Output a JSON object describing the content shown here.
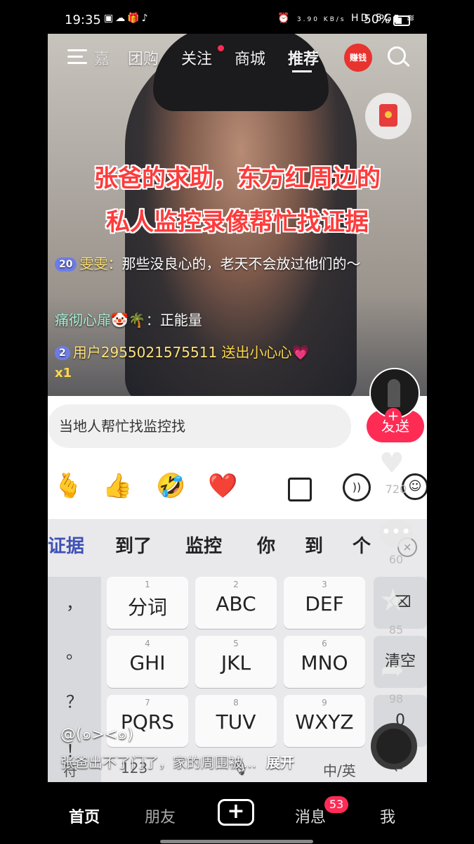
{
  "status": {
    "time": "19:35",
    "net_speed": "3.90 KB/s",
    "signal": "5G",
    "battery": "50%"
  },
  "topnav": {
    "partial_tab": "嘉",
    "tabs": [
      "团购",
      "关注",
      "商城",
      "推荐"
    ],
    "earn_label": "赚钱"
  },
  "video": {
    "title_line1": "张爸的求助，东方红周边的",
    "title_line2": "私人监控录像帮忙找证据"
  },
  "chat": [
    {
      "badge": "20",
      "user": "雯雯：",
      "text": "那些没良心的，老天不会放过他们的～"
    },
    {
      "user": "痛彻心扉🤡🌴：",
      "text": "正能量"
    },
    {
      "badge": "2",
      "user": "用户2955021575511",
      "text": "送出小心心💗",
      "count": "x1"
    }
  ],
  "input": {
    "value": "当地人帮忙找监控找",
    "send_label": "发送"
  },
  "emojis": [
    "🫰",
    "👍",
    "🤣",
    "❤️"
  ],
  "side": {
    "likes": "720",
    "comments": "60",
    "favorites": "85",
    "shares": "98"
  },
  "keyboard": {
    "candidates": [
      "证据",
      "到了",
      "监控",
      "你",
      "到",
      "个"
    ],
    "punct": [
      "，",
      "。",
      "？",
      "！"
    ],
    "keys": [
      {
        "num": "1",
        "label": "分词"
      },
      {
        "num": "2",
        "label": "ABC"
      },
      {
        "num": "3",
        "label": "DEF"
      },
      {
        "num": "4",
        "label": "GHI"
      },
      {
        "num": "5",
        "label": "JKL"
      },
      {
        "num": "6",
        "label": "MNO"
      },
      {
        "num": "7",
        "label": "PQRS"
      },
      {
        "num": "8",
        "label": "TUV"
      },
      {
        "num": "9",
        "label": "WXYZ"
      }
    ],
    "clear_label": "清空",
    "zero_label": "0",
    "bottom": {
      "symbol": "符",
      "num": "123",
      "lang": "中/英"
    }
  },
  "post": {
    "author": "@(๑><๑)",
    "caption": "张爸出不了门了，家的周围被...",
    "expand": "展开"
  },
  "bottomnav": {
    "home": "首页",
    "friends": "朋友",
    "create": "+",
    "messages": "消息",
    "messages_badge": "53",
    "me": "我"
  }
}
